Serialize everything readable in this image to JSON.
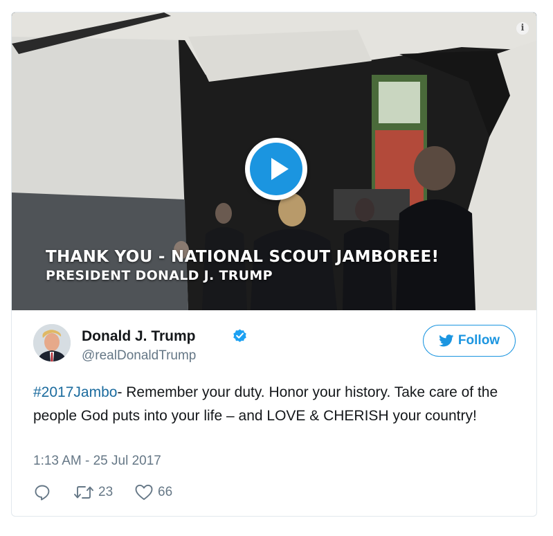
{
  "media": {
    "caption_line1": "THANK YOU - NATIONAL SCOUT JAMBOREE!",
    "caption_line2": "PRESIDENT DONALD J. TRUMP",
    "play_icon": "play-icon",
    "info_icon_glyph": "i"
  },
  "author": {
    "name": "Donald J. Trump",
    "handle": "@realDonaldTrump",
    "verified": true
  },
  "follow_label": "Follow",
  "tweet": {
    "hashtag": "#2017Jambo",
    "body": "- Remember your duty. Honor your history. Take care of the people God puts into your life – and LOVE & CHERISH your country!",
    "timestamp": "1:13 AM - 25 Jul 2017"
  },
  "actions": {
    "retweets": "23",
    "likes": "66"
  },
  "colors": {
    "twitter_blue": "#1b95e0",
    "hashtag": "#1b6b9e",
    "secondary_text": "#657786"
  }
}
